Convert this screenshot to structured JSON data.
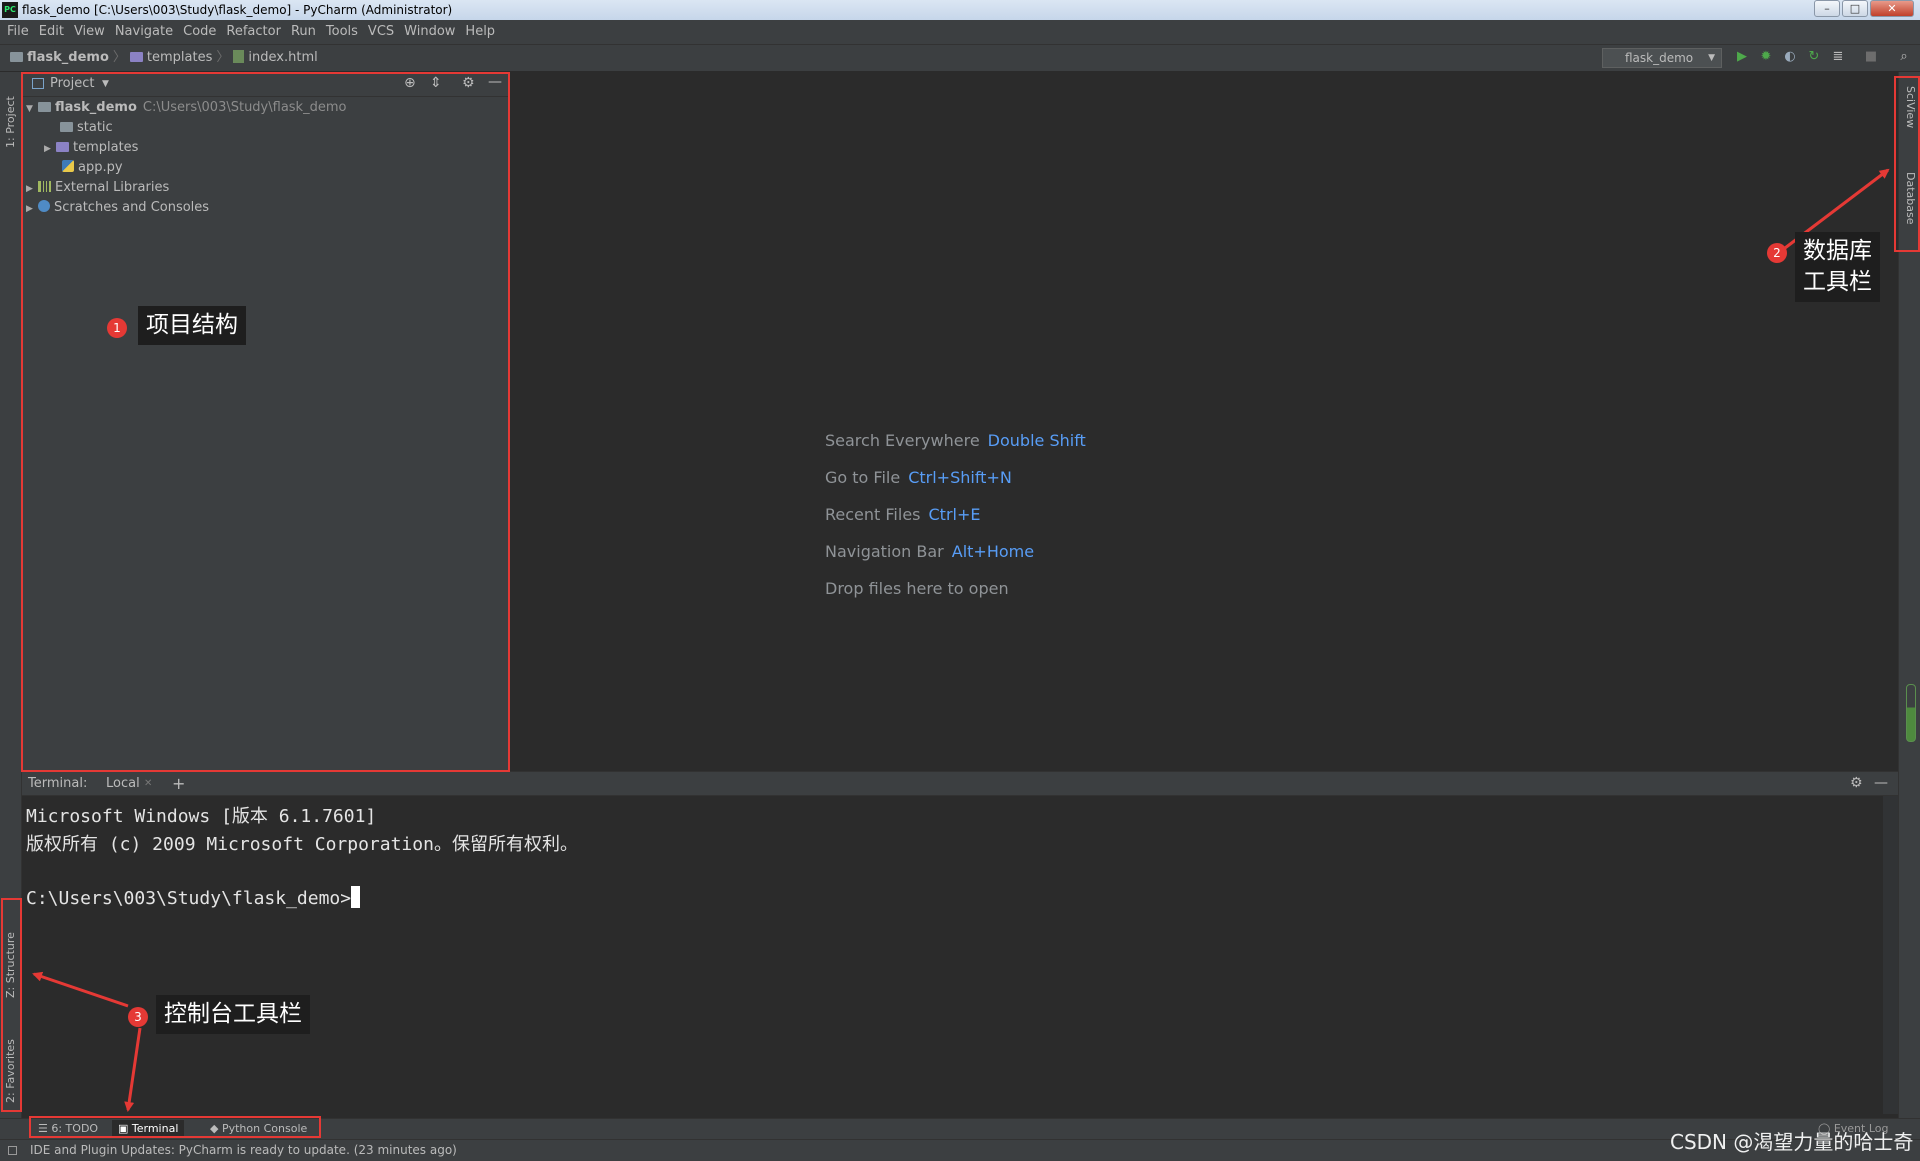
{
  "window": {
    "title": "flask_demo [C:\\Users\\003\\Study\\flask_demo] - PyCharm (Administrator)",
    "logo_text": "PC",
    "buttons": [
      "–",
      "□",
      "✕"
    ]
  },
  "menu": [
    "File",
    "Edit",
    "View",
    "Navigate",
    "Code",
    "Refactor",
    "Run",
    "Tools",
    "VCS",
    "Window",
    "Help"
  ],
  "breadcrumb": [
    "flask_demo",
    "templates",
    "index.html"
  ],
  "run_config": "flask_demo",
  "left_stripe": {
    "project": "1: Project",
    "structure": "Z: Structure",
    "favorites": "2: Favorites"
  },
  "right_stripe": {
    "sciview": "SciView",
    "database": "Database"
  },
  "project": {
    "title": "Project",
    "tree": [
      {
        "label": "flask_demo",
        "path": "C:\\Users\\003\\Study\\flask_demo"
      },
      {
        "label": "static"
      },
      {
        "label": "templates"
      },
      {
        "label": "app.py"
      },
      {
        "label": "External Libraries"
      },
      {
        "label": "Scratches and Consoles"
      }
    ]
  },
  "welcome": [
    {
      "text": "Search Everywhere",
      "key": "Double Shift"
    },
    {
      "text": "Go to File",
      "key": "Ctrl+Shift+N"
    },
    {
      "text": "Recent Files",
      "key": "Ctrl+E"
    },
    {
      "text": "Navigation Bar",
      "key": "Alt+Home"
    },
    {
      "text": "Drop files here to open",
      "key": ""
    }
  ],
  "terminal": {
    "label": "Terminal:",
    "tab": "Local",
    "lines": [
      "Microsoft Windows [版本 6.1.7601]",
      "版权所有 (c) 2009 Microsoft Corporation。保留所有权利。",
      "",
      "C:\\Users\\003\\Study\\flask_demo>"
    ]
  },
  "bottom_tabs": [
    "6: TODO",
    "Terminal",
    "Python Console"
  ],
  "event_log": "Event Log",
  "status": "IDE and Plugin Updates: PyCharm is ready to update. (23 minutes ago)",
  "annotations": [
    {
      "num": "1",
      "text": "项目结构"
    },
    {
      "num": "2",
      "text": "数据库\n工具栏"
    },
    {
      "num": "3",
      "text": "控制台工具栏"
    }
  ],
  "watermark": "CSDN @渴望力量的哈士奇",
  "colors": {
    "accent_key": "#589df6",
    "annotation_red": "#e53935",
    "bg_dark": "#2b2b2b",
    "panel": "#3c3f41"
  }
}
